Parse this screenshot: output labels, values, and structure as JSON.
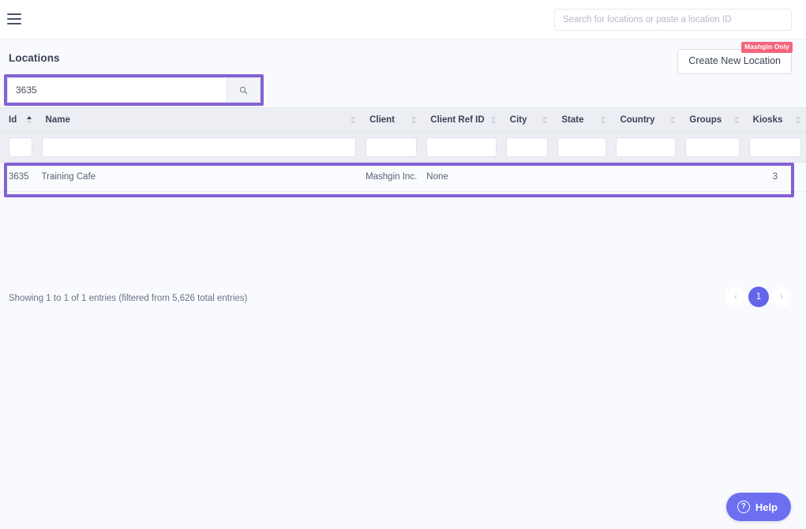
{
  "topbar": {
    "menu_icon": "hamburger-icon",
    "global_search_placeholder": "Search for locations or paste a location ID",
    "global_search_value": ""
  },
  "page": {
    "title": "Locations",
    "create_button_label": "Create New Location",
    "create_button_badge": "Mashgin Only"
  },
  "location_search": {
    "value": "3635",
    "placeholder": "",
    "button_icon": "search-icon",
    "highlight_color": "#8461d4"
  },
  "table": {
    "columns": [
      {
        "label": "Id",
        "sort": "asc"
      },
      {
        "label": "Name",
        "sort": "none"
      },
      {
        "label": "Client",
        "sort": "none"
      },
      {
        "label": "Client Ref ID",
        "sort": "none"
      },
      {
        "label": "City",
        "sort": "none"
      },
      {
        "label": "State",
        "sort": "none"
      },
      {
        "label": "Country",
        "sort": "none"
      },
      {
        "label": "Groups",
        "sort": "none"
      },
      {
        "label": "Kiosks",
        "sort": "none"
      }
    ],
    "filters": [
      "",
      "",
      "",
      "",
      "",
      "",
      "",
      "",
      ""
    ],
    "rows": [
      {
        "id": "3635",
        "name": "Training Cafe",
        "client": "Mashgin Inc.",
        "client_ref_id": "None",
        "city": "",
        "state": "",
        "country": "",
        "groups": "",
        "kiosks": "3",
        "highlighted": true
      }
    ]
  },
  "footer": {
    "info": "Showing 1 to 1 of 1 entries (filtered from 5,626 total entries)",
    "prev_label": "‹",
    "next_label": "›",
    "current_page": "1"
  },
  "help": {
    "label": "Help",
    "icon": "question-circle-icon",
    "mark": "?"
  },
  "colors": {
    "accent": "#6366e8",
    "highlight": "#8461d4",
    "badge": "#f5647c",
    "page_bg": "#f9fafd",
    "header_bg": "#eceef4"
  }
}
